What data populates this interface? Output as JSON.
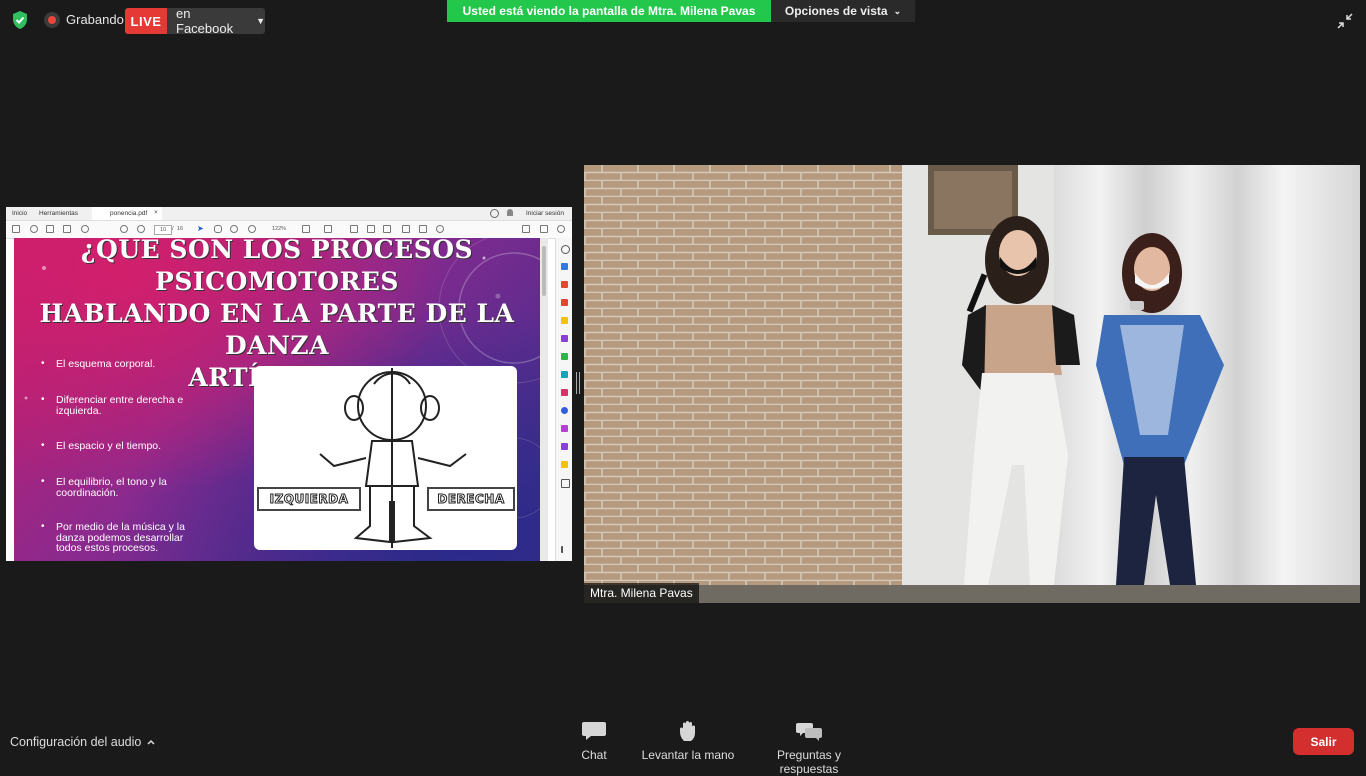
{
  "top_bar": {
    "recording_label": "Grabando",
    "live_badge": "LIVE",
    "live_destination": "en Facebook",
    "viewing_banner": "Usted está viendo la pantalla de Mtra. Milena Pavas",
    "view_options": "Opciones de vista"
  },
  "shared_screen": {
    "pdf_app": {
      "tabs": [
        "Inicio",
        "Herramientas"
      ],
      "file_tab": "ponencia.pdf",
      "sign_in": "Iniciar sesión",
      "page_current": "10",
      "page_sep": "/",
      "page_total": "16",
      "zoom": "122%"
    },
    "slide": {
      "title_lines": [
        "¿QUE SON LOS PROCESOS PSICOMOTORES",
        "HABLANDO EN LA PARTE DE LA DANZA",
        "ARTÍSTICA?"
      ],
      "bullets": [
        "El esquema corporal.",
        "Diferenciar entre derecha e izquierda.",
        "El espacio y el tiempo.",
        "El equilibrio, el tono y la coordinación.",
        "Por medio de la música y la danza podemos desarrollar todos estos procesos."
      ],
      "image_label_left": "IZQUIERDA",
      "image_label_right": "DERECHA"
    }
  },
  "video": {
    "participant_name": "Mtra. Milena Pavas"
  },
  "bottom_bar": {
    "audio_config": "Configuración del audio",
    "controls": [
      {
        "label": "Chat",
        "icon": "chat-bubble-icon"
      },
      {
        "label": "Levantar la mano",
        "icon": "raise-hand-icon"
      },
      {
        "label": "Preguntas y respuestas",
        "icon": "qa-bubbles-icon"
      }
    ],
    "exit_label": "Salir"
  },
  "colors": {
    "banner_green": "#23c74c",
    "live_red": "#e53935",
    "exit_red": "#d32f2f",
    "background": "#1a1a1a"
  }
}
